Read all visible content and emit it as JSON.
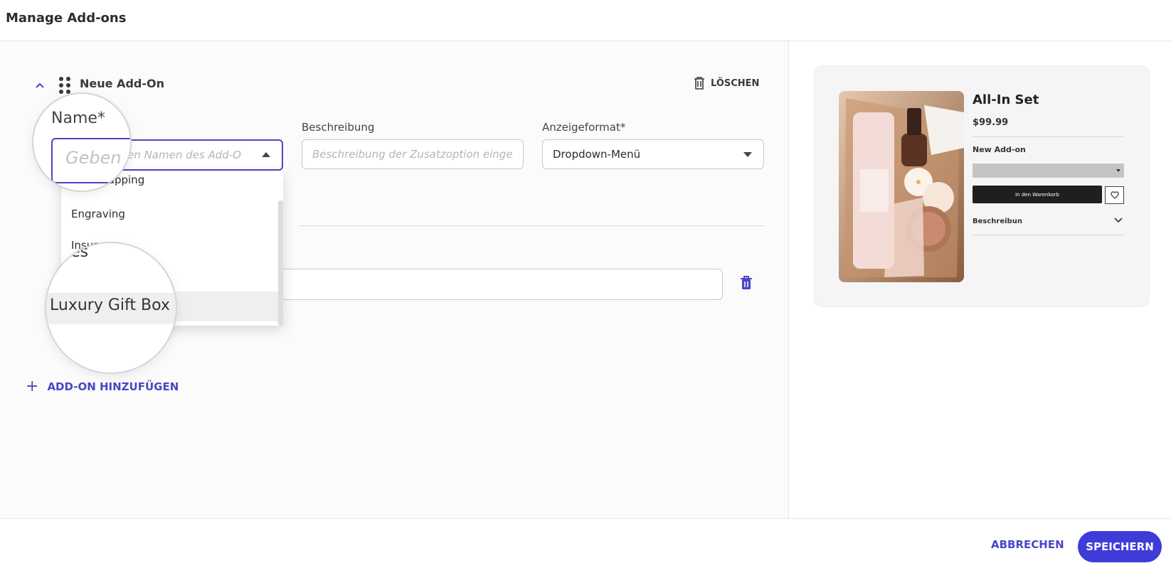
{
  "header": {
    "title": "Manage Add-ons"
  },
  "addon": {
    "title": "Neue Add-On",
    "delete_label": "LÖSCHEN",
    "name_label": "Name*",
    "name_placeholder": "Geben Sie den Namen des Add-O",
    "description_label": "Beschreibung",
    "description_placeholder": "Beschreibung der Zusatzoption einge...",
    "format_label": "Anzeigeformat*",
    "format_value": "Dropdown-Menü"
  },
  "dropdown": {
    "options": [
      "Gift Wrapping",
      "Engraving",
      "Insurance",
      "Luxury Gift Box"
    ],
    "highlighted": "Luxury Gift Box"
  },
  "magnifiers": {
    "name_label": "Name*",
    "name_placeholder": "Geben",
    "prices_fragment": "ces",
    "option": "Luxury Gift Box"
  },
  "add_button": {
    "label": "ADD-ON HINZUFÜGEN"
  },
  "preview": {
    "product_title": "All-In Set",
    "price": "$99.99",
    "addon_label": "New Add-on",
    "cart_button": "In den Warenkorb",
    "description_label": "Beschreibun"
  },
  "footer": {
    "cancel_label": "ABBRECHEN",
    "save_label": "SPEICHERN"
  },
  "colors": {
    "accent": "#4a46c6",
    "primary_button": "#3f3bd8",
    "cart_button": "#1f1f1f"
  }
}
